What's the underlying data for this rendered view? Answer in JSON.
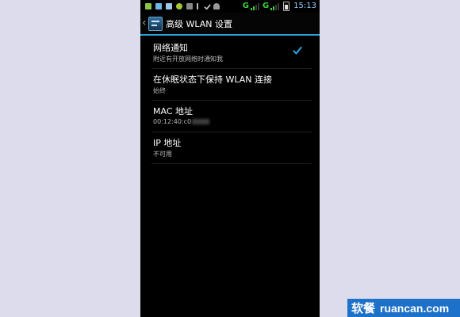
{
  "statusbar": {
    "network_1": "G",
    "network_2": "G",
    "time": "15:13",
    "icons": [
      "gallery-icon",
      "android-icon",
      "app-icon",
      "android-icon",
      "sd-card-icon",
      "usb-icon",
      "check-icon",
      "android-icon"
    ]
  },
  "actionbar": {
    "title": "高级 WLAN 设置"
  },
  "settings": [
    {
      "title": "网络通知",
      "summary": "附近有开放网络时通知我",
      "checked": true
    },
    {
      "title": "在休眠状态下保持 WLAN 连接",
      "summary": "始终"
    },
    {
      "title": "MAC 地址",
      "summary": "00:12:40:c0"
    },
    {
      "title": "IP 地址",
      "summary": "不可用"
    }
  ],
  "watermark": {
    "cn": "软餐",
    "en": "ruancan.com"
  },
  "colors": {
    "accent": "#2b9fd8",
    "signal": "#39d33b",
    "background": "#000000",
    "page_bg": "#dcdcec"
  }
}
